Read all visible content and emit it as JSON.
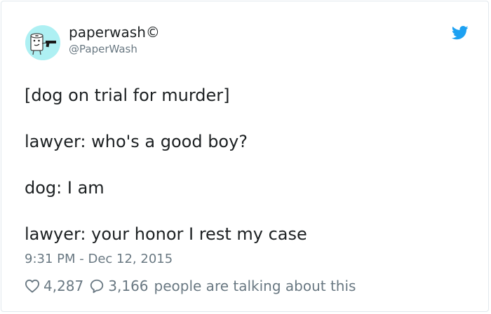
{
  "user": {
    "display_name": "paperwash©",
    "handle": "@PaperWash",
    "avatar_icon": "paper-towel-cartoon-with-gun",
    "avatar_bg": "#aef0f3"
  },
  "brand": {
    "icon": "twitter-bird-icon",
    "color": "#1da1f2"
  },
  "tweet": {
    "lines": [
      "[dog on trial for murder]",
      "lawyer: who's a good boy?",
      "dog: I am",
      "lawyer: your honor I rest my case"
    ],
    "timestamp": "9:31 PM - Dec 12, 2015"
  },
  "engagement": {
    "likes": "4,287",
    "replies": "3,166",
    "talking_text": "people are talking about this",
    "like_icon": "heart-icon",
    "reply_icon": "speech-bubble-icon",
    "icon_color": "#697882"
  }
}
